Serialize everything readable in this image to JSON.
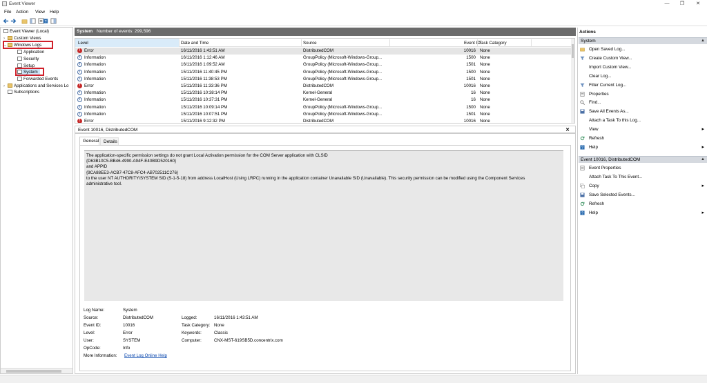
{
  "window": {
    "title": "Event Viewer",
    "minimize": "—",
    "restore": "❐",
    "close": "✕"
  },
  "menu": [
    "File",
    "Action",
    "View",
    "Help"
  ],
  "tree": {
    "root": "Event Viewer (Local)",
    "custom_views": "Custom Views",
    "windows_logs": "Windows Logs",
    "application": "Application",
    "security": "Security",
    "setup": "Setup",
    "system": "System",
    "forwarded": "Forwarded Events",
    "apps_services": "Applications and Services Lo",
    "subscriptions": "Subscriptions"
  },
  "center": {
    "log_name": "System",
    "event_count": "Number of events: 299,596"
  },
  "grid": {
    "columns": [
      "Level",
      "Date and Time",
      "Source",
      "Event ID",
      "Task Category"
    ],
    "rows": [
      {
        "level": "Error",
        "date": "16/11/2016 1:43:51 AM",
        "source": "DistributedCOM",
        "id": "10016",
        "task": "None"
      },
      {
        "level": "Information",
        "date": "16/11/2016 1:12:46 AM",
        "source": "GroupPolicy (Microsoft-Windows-Group...",
        "id": "1500",
        "task": "None"
      },
      {
        "level": "Information",
        "date": "16/11/2016 1:09:52 AM",
        "source": "GroupPolicy (Microsoft-Windows-Group...",
        "id": "1501",
        "task": "None"
      },
      {
        "level": "Information",
        "date": "15/11/2016 11:40:45 PM",
        "source": "GroupPolicy (Microsoft-Windows-Group...",
        "id": "1500",
        "task": "None"
      },
      {
        "level": "Information",
        "date": "15/11/2016 11:38:53 PM",
        "source": "GroupPolicy (Microsoft-Windows-Group...",
        "id": "1501",
        "task": "None"
      },
      {
        "level": "Error",
        "date": "15/11/2016 11:33:36 PM",
        "source": "DistributedCOM",
        "id": "10016",
        "task": "None"
      },
      {
        "level": "Information",
        "date": "15/11/2016 10:38:14 PM",
        "source": "Kernel-General",
        "id": "16",
        "task": "None"
      },
      {
        "level": "Information",
        "date": "15/11/2016 10:37:31 PM",
        "source": "Kernel-General",
        "id": "16",
        "task": "None"
      },
      {
        "level": "Information",
        "date": "15/11/2016 10:09:14 PM",
        "source": "GroupPolicy (Microsoft-Windows-Group...",
        "id": "1500",
        "task": "None"
      },
      {
        "level": "Information",
        "date": "15/11/2016 10:07:51 PM",
        "source": "GroupPolicy (Microsoft-Windows-Group...",
        "id": "1501",
        "task": "None"
      },
      {
        "level": "Error",
        "date": "15/11/2016 9:12:32 PM",
        "source": "DistributedCOM",
        "id": "10016",
        "task": "None"
      }
    ]
  },
  "detail": {
    "header": "Event 10016, DistributedCOM",
    "close": "✕",
    "tabs": [
      "General",
      "Details"
    ],
    "message_lines": [
      "The application-specific permission settings do not grant Local Activation permission for the COM Server application with CLSID",
      "{D63B10C5-BB46-4990-A94F-E40B9D520160}",
      " and APPID",
      "{9CA88EE3-ACB7-47C8-AFC4-AB702511C276}",
      " to the user NT AUTHORITY\\SYSTEM SID (S-1-5-18) from address LocalHost (Using LRPC) running in the application container Unavailable SID (Unavailable). This security permission can be modified using the Component Services",
      "administrative tool."
    ],
    "props": {
      "log_name_label": "Log Name:",
      "log_name": "System",
      "source_label": "Source:",
      "source": "DistributedCOM",
      "logged_label": "Logged:",
      "logged": "16/11/2016 1:43:51 AM",
      "event_id_label": "Event ID:",
      "event_id": "10016",
      "task_label": "Task Category:",
      "task": "None",
      "level_label": "Level:",
      "level": "Error",
      "keywords_label": "Keywords:",
      "keywords": "Classic",
      "user_label": "User:",
      "user": "SYSTEM",
      "computer_label": "Computer:",
      "computer": "CNX-MST-619SB5D.concentrix.com",
      "opcode_label": "OpCode:",
      "opcode": "Info",
      "more_info_label": "More Information:",
      "more_info": "Event Log Online Help"
    }
  },
  "actions": {
    "title": "Actions",
    "system_section": "System",
    "system_items": [
      "Open Saved Log...",
      "Create Custom View...",
      "Import Custom View...",
      "Clear Log...",
      "Filter Current Log...",
      "Properties",
      "Find...",
      "Save All Events As...",
      "Attach a Task To this Log...",
      "View",
      "Refresh",
      "Help"
    ],
    "event_section": "Event 10016, DistributedCOM",
    "event_items": [
      "Event Properties",
      "Attach Task To This Event...",
      "Copy",
      "Save Selected Events...",
      "Refresh",
      "Help"
    ]
  }
}
